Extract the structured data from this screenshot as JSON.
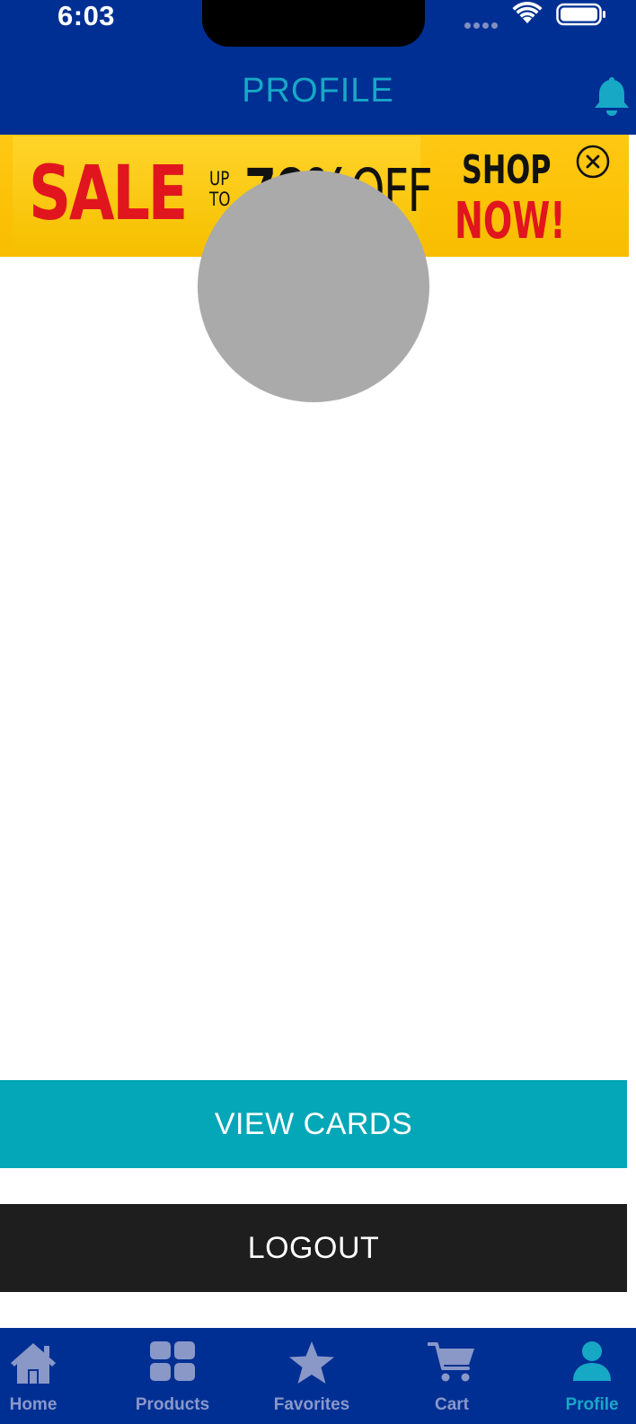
{
  "status_bar": {
    "time": "6:03"
  },
  "header": {
    "title": "PROFILE",
    "notification_icon": "bell-icon"
  },
  "banner": {
    "sale": "SALE",
    "up_to": "UP TO",
    "discount": "70%",
    "off": "OFF",
    "shop": "SHOP",
    "now": "NOW!",
    "close_icon": "close-circle-icon"
  },
  "profile": {
    "avatar": "avatar-placeholder"
  },
  "actions": {
    "view_cards": "VIEW CARDS",
    "logout": "LOGOUT"
  },
  "tabs": [
    {
      "label": "Home",
      "icon": "home-icon",
      "active": false
    },
    {
      "label": "Products",
      "icon": "grid-icon",
      "active": false
    },
    {
      "label": "Favorites",
      "icon": "star-icon",
      "active": false
    },
    {
      "label": "Cart",
      "icon": "cart-icon",
      "active": false
    },
    {
      "label": "Profile",
      "icon": "person-icon",
      "active": true
    }
  ],
  "colors": {
    "header_bg": "#002f93",
    "accent": "#17a8c6",
    "view_cards_bg": "#04a7b7",
    "logout_bg": "#1e1e1e",
    "avatar_bg": "#aaaaaa",
    "banner_bg": "#ffc812",
    "sale_red": "#e1151e",
    "tab_inactive": "#8a98c8"
  }
}
